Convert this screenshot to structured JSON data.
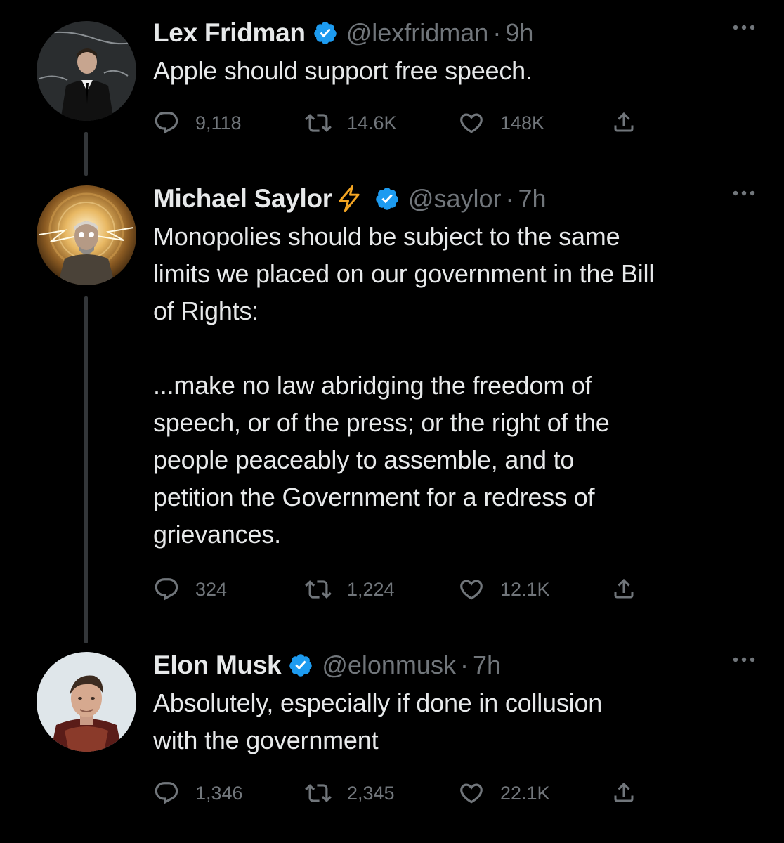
{
  "tweets": [
    {
      "name": "Lex Fridman",
      "emoji": "",
      "handle": "@lexfridman",
      "time": "9h",
      "text": "Apple should support free speech.",
      "replies": "9,118",
      "retweets": "14.6K",
      "likes": "148K"
    },
    {
      "name": "Michael Saylor",
      "emoji": "lightning-bolt-emoji",
      "handle": "@saylor",
      "time": "7h",
      "text": "Monopolies should be subject to the same\nlimits we placed on our government in the Bill\nof Rights:\n\n...make no law abridging the freedom of\nspeech, or of the press; or the right of the\npeople peaceably to assemble, and to\npetition the Government for a redress of\ngrievances.",
      "replies": "324",
      "retweets": "1,224",
      "likes": "12.1K"
    },
    {
      "name": "Elon Musk",
      "emoji": "",
      "handle": "@elonmusk",
      "time": "7h",
      "text": "Absolutely, especially if done in collusion\nwith the government",
      "replies": "1,346",
      "retweets": "2,345",
      "likes": "22.1K"
    }
  ],
  "separator": "·",
  "colors": {
    "background": "#000000",
    "text": "#e7e9ea",
    "secondary": "#71767b",
    "verified": "#1d9bf0",
    "thread_line": "#333639"
  },
  "icons": [
    "reply-icon",
    "retweet-icon",
    "like-icon",
    "share-icon",
    "verified-badge-icon",
    "more-options-icon"
  ]
}
